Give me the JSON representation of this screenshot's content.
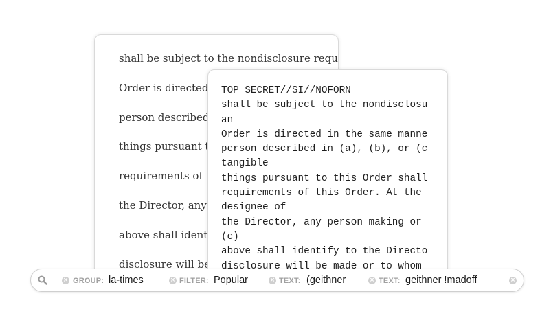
{
  "back_document": {
    "lines": [
      "shall be subject to the nondisclosure requirem",
      "Order is directed i",
      "person described i",
      "things pursuant to",
      "requirements of th",
      "the Director, any p",
      "above shall identif",
      "disclosure will be"
    ]
  },
  "front_document": {
    "lines": [
      "TOP SECRET//SI//NOFORN",
      "shall be subject to the nondisclosu",
      "an",
      "Order is directed in the same manne",
      "person described in (a), (b), or (c",
      "tangible",
      "things pursuant to this Order shall",
      "requirements of this Order. At the ",
      "designee of",
      "the Director, any person making or ",
      "(c)",
      "above shall identify to the Directo",
      "disclosure will be made or to whom "
    ]
  },
  "search": {
    "icon": "search-icon",
    "facets": [
      {
        "category": "GROUP:",
        "value": "la-times"
      },
      {
        "category": "FILTER:",
        "value": "Popular"
      },
      {
        "category": "TEXT:",
        "value": "(geithner"
      },
      {
        "category": "TEXT:",
        "value": "geithner !madoff"
      }
    ]
  }
}
